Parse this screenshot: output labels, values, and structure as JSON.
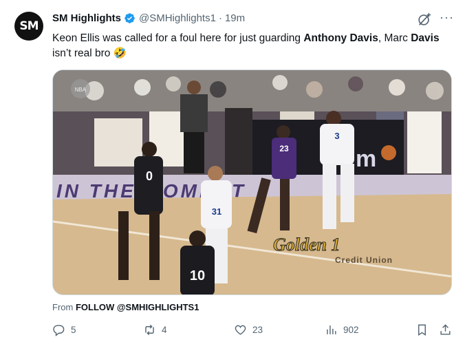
{
  "tweet": {
    "avatar_text": "SM",
    "display_name": "SM Highlights",
    "handle": "@SMHighlights1",
    "separator": "·",
    "time": "19m",
    "text_1": "Keon Ellis was called for a foul here for just guarding ",
    "text_bold_1": "Anthony Davis",
    "text_2": ", Marc ",
    "text_bold_2": "Davis",
    "text_3": " isn’t real bro 🤣",
    "media_alt": "Basketball game video clip",
    "from_label": "From ",
    "from_source": "FOLLOW @SMHIGHLIGHTS1"
  },
  "media_text": {
    "court_text": "IN THE MOMENT",
    "sponsor": "Golden 1",
    "sponsor_sub": "Credit Union",
    "jersey_3": "3",
    "jersey_31": "31",
    "jersey_23": "23",
    "jersey_0": "0",
    "jersey_10": "10",
    "sign_text": "NBA"
  },
  "actions": {
    "replies": "5",
    "reposts": "4",
    "likes": "23",
    "views": "902"
  },
  "colors": {
    "verified": "#1d9bf0",
    "muted": "#536471",
    "text": "#0f1419"
  }
}
